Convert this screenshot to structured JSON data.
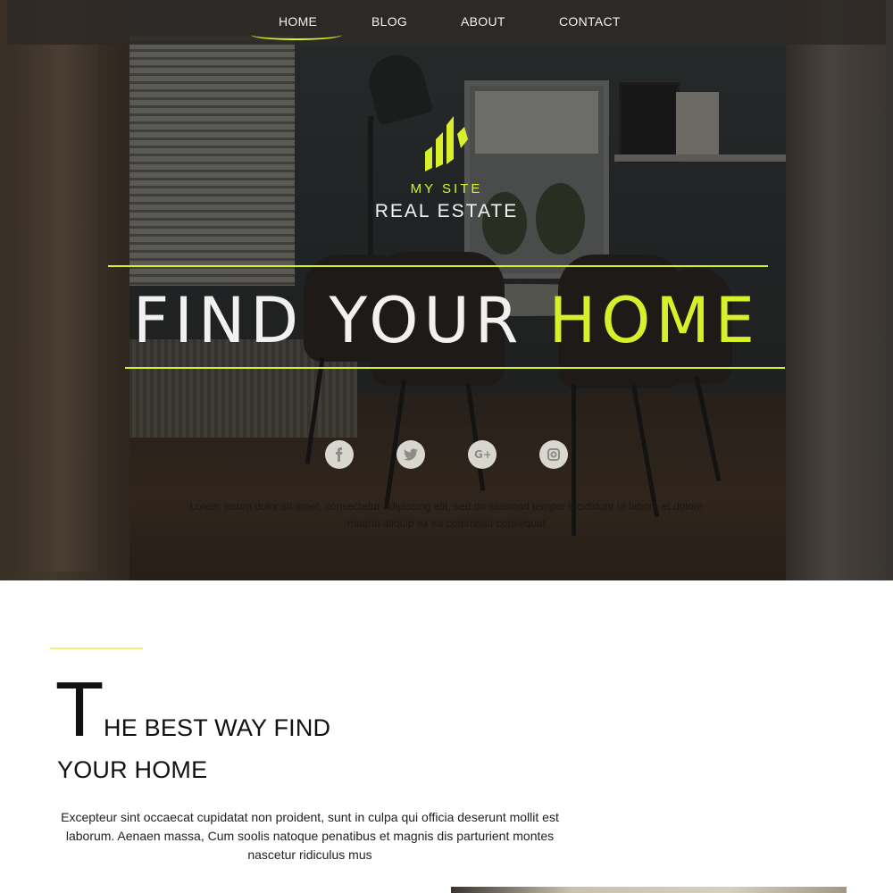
{
  "nav": {
    "items": [
      {
        "label": "HOME",
        "active": true
      },
      {
        "label": "BLOG",
        "active": false
      },
      {
        "label": "ABOUT",
        "active": false
      },
      {
        "label": "CONTACT",
        "active": false
      }
    ]
  },
  "logo": {
    "top": "MY SITE",
    "bottom": "REAL ESTATE",
    "icon": "bar-chart-logo-icon"
  },
  "hero": {
    "headline_part1": "FIND YOUR ",
    "headline_part2": "HOME",
    "social": [
      "facebook-icon",
      "twitter-icon",
      "google-plus-icon",
      "instagram-icon"
    ],
    "text": "Lorem ipsum dolor sit amet, consectetur adipiscing elit, sed do eiusmod tempor incididunt ut labore et dolore magna aliquip ex ea commodo consequat"
  },
  "section": {
    "dropcap": "T",
    "heading_line1": "HE BEST WAY FIND",
    "heading_line2": "YOUR HOME",
    "body": "Excepteur sint occaecat cupidatat non proident, sunt in culpa qui officia deserunt mollit est laborum. Aenaen massa, Cum soolis natoque penatibus et magnis dis parturient montes nascetur ridiculus mus"
  },
  "colors": {
    "accent": "#d8f02a",
    "nav_bg": "#2d2926"
  }
}
